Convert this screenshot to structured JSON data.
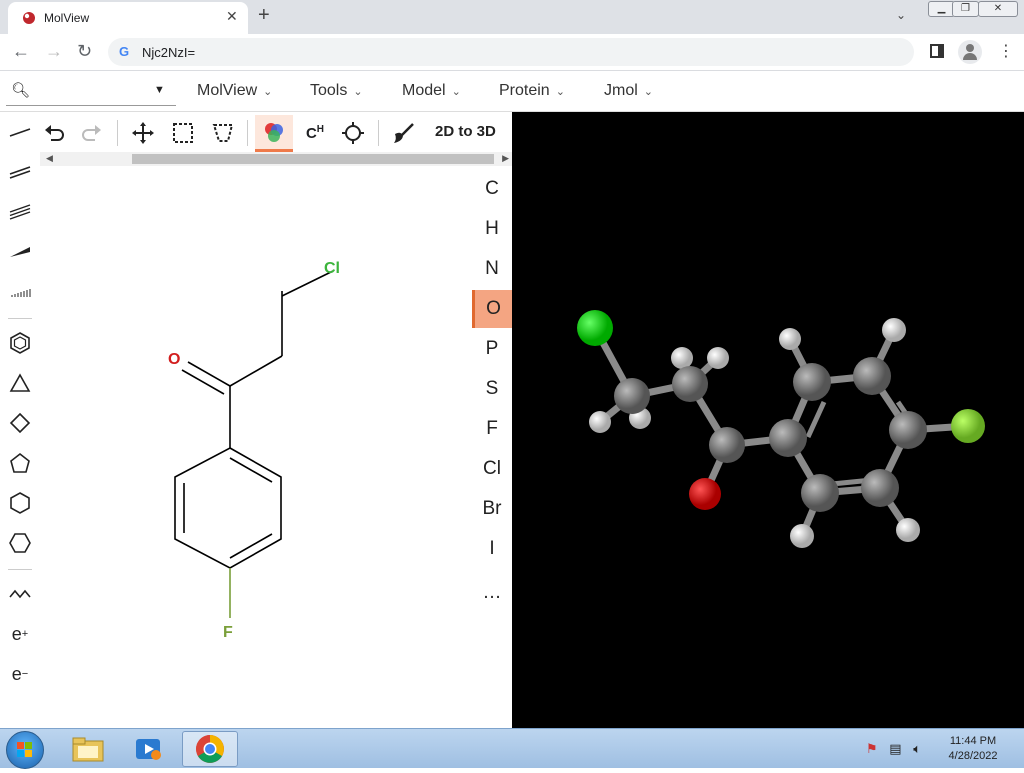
{
  "browser": {
    "tab_title": "MolView",
    "tab_close": "✕",
    "new_tab": "+",
    "address": "Njc2NzI=",
    "google_g": "G"
  },
  "menubar": {
    "menus": [
      "MolView",
      "Tools",
      "Model",
      "Protein",
      "Jmol"
    ]
  },
  "sketch_toolbar": {
    "to3d_label": "2D to 3D",
    "tools": [
      "undo-icon",
      "redo-icon",
      "move-icon",
      "rect-select-icon",
      "lasso-select-icon",
      "color-mode-icon",
      "hydrogen-icon",
      "center-icon",
      "erase-icon"
    ],
    "active_tool": "color-mode-icon"
  },
  "left_tools": [
    "single-bond",
    "double-bond",
    "triple-bond",
    "wedge-bond",
    "hash-bond",
    "benzene",
    "triangle",
    "square",
    "pentagon",
    "hexagon",
    "hexagon-2",
    "chain",
    "e+",
    "e−"
  ],
  "electron_plus": "e",
  "electron_minus": "e",
  "plus_sup": "+",
  "minus_sup": "−",
  "elements": [
    "C",
    "H",
    "N",
    "O",
    "P",
    "S",
    "F",
    "Cl",
    "Br",
    "I",
    "…"
  ],
  "active_element": "O",
  "molecule_labels": {
    "chlorine": "Cl",
    "oxygen": "O",
    "fluorine": "F"
  },
  "colors": {
    "chlorine": "#3cb43c",
    "oxygen": "#d21e1e",
    "fluorine": "#7a9f3a",
    "accent": "#ef7a4a"
  },
  "taskbar": {
    "time": "11:44 PM",
    "date": "4/28/2022"
  }
}
